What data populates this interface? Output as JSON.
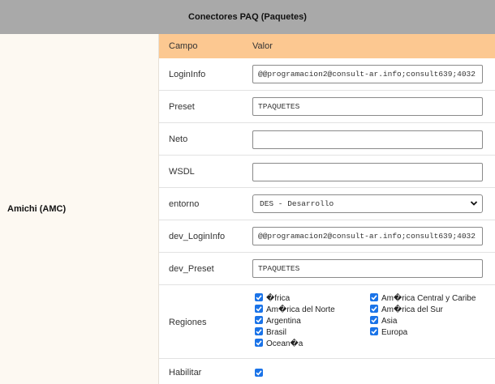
{
  "header": {
    "title": "Conectores PAQ (Paquetes)"
  },
  "provider": {
    "name": "Amichi (AMC)"
  },
  "table": {
    "col_campo": "Campo",
    "col_valor": "Valor"
  },
  "fields": {
    "logininfo": {
      "label": "LoginInfo",
      "value": "@@programacion2@consult-ar.info;consult639;4032"
    },
    "preset": {
      "label": "Preset",
      "value": "TPAQUETES"
    },
    "neto": {
      "label": "Neto",
      "value": ""
    },
    "wsdl": {
      "label": "WSDL",
      "value": ""
    },
    "entorno": {
      "label": "entorno",
      "value": "DES - Desarrollo"
    },
    "dev_logininfo": {
      "label": "dev_LoginInfo",
      "value": "@@programacion2@consult-ar.info;consult639;4032"
    },
    "dev_preset": {
      "label": "dev_Preset",
      "value": "TPAQUETES"
    },
    "regiones": {
      "label": "Regiones"
    },
    "habilitar": {
      "label": "Habilitar",
      "checked": true
    }
  },
  "regions": [
    {
      "label": "�frica",
      "checked": true
    },
    {
      "label": "Am�rica del Norte",
      "checked": true
    },
    {
      "label": "Argentina",
      "checked": true
    },
    {
      "label": "Brasil",
      "checked": true
    },
    {
      "label": "Ocean�a",
      "checked": true
    },
    {
      "label": "Am�rica Central y Caribe",
      "checked": true
    },
    {
      "label": "Am�rica del Sur",
      "checked": true
    },
    {
      "label": "Asia",
      "checked": true
    },
    {
      "label": "Europa",
      "checked": true
    }
  ],
  "colors": {
    "header_bg": "#a9a9a9",
    "thead_bg": "#fcc891",
    "checkbox": "#1a73e8"
  }
}
